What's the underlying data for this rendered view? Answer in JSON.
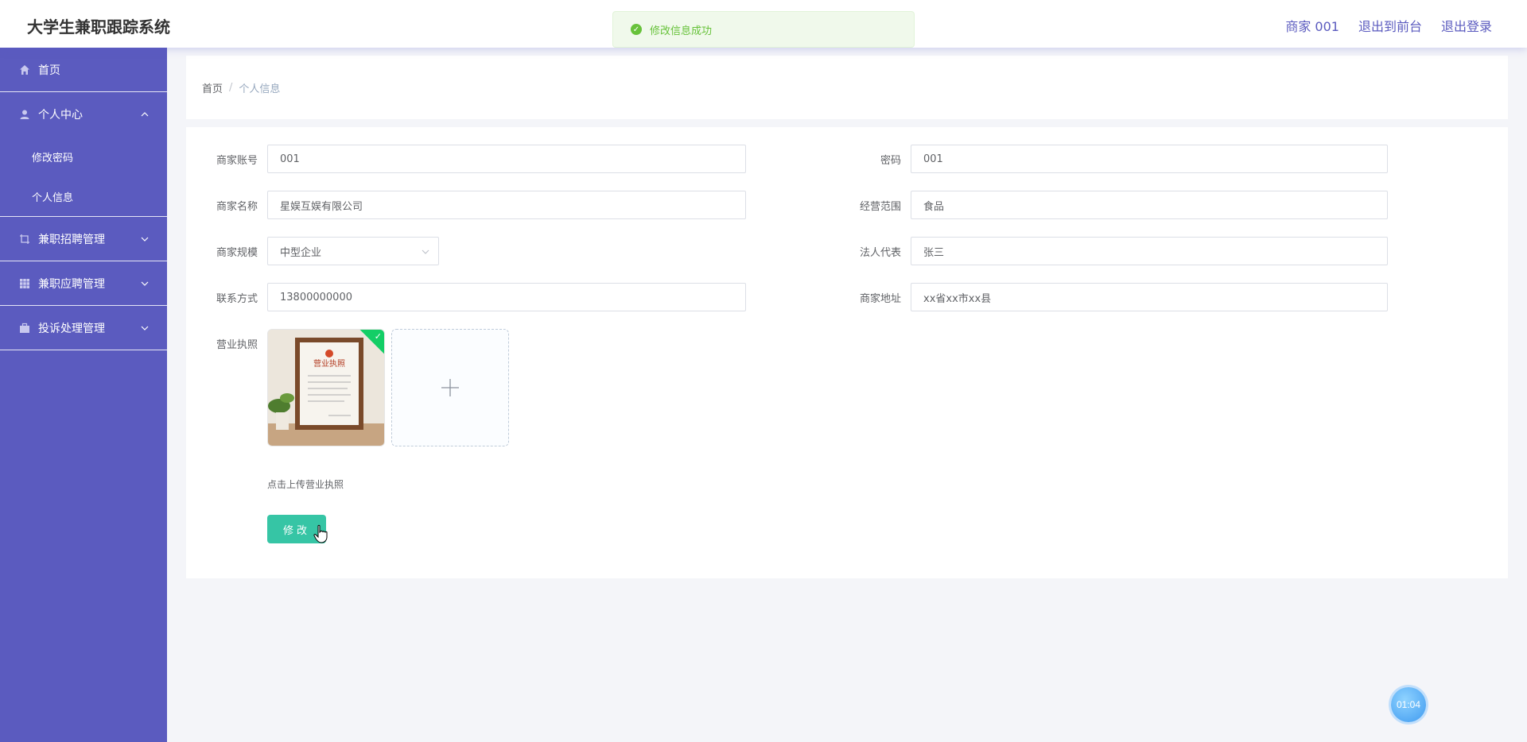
{
  "app": {
    "title": "大学生兼职跟踪系统"
  },
  "header": {
    "links": [
      "商家 001",
      "退出到前台",
      "退出登录"
    ]
  },
  "toast": {
    "message": "修改信息成功"
  },
  "sidebar": {
    "home": "首页",
    "personal_center": "个人中心",
    "personal_sub": [
      "修改密码",
      "个人信息"
    ],
    "recruit_manage": "兼职招聘管理",
    "apply_manage": "兼职应聘管理",
    "complaint_manage": "投诉处理管理"
  },
  "breadcrumb": {
    "home": "首页",
    "sep": "/",
    "current": "个人信息"
  },
  "form": {
    "account_label": "商家账号",
    "account_value": "001",
    "password_label": "密码",
    "password_value": "001",
    "name_label": "商家名称",
    "name_value": "星娱互娱有限公司",
    "scope_label": "经营范围",
    "scope_value": "食品",
    "scale_label": "商家规模",
    "scale_value": "中型企业",
    "legal_label": "法人代表",
    "legal_value": "张三",
    "contact_label": "联系方式",
    "contact_value": "13800000000",
    "address_label": "商家地址",
    "address_value": "xx省xx市xx县",
    "license_label": "营业执照",
    "license_tip": "点击上传营业执照",
    "license_image_text": "营业执照",
    "submit_label": "修改"
  },
  "timer": {
    "value": "01:04"
  },
  "colors": {
    "sidebar": "#5b5bbf",
    "accent": "#36c5a5",
    "success": "#67c23a"
  }
}
